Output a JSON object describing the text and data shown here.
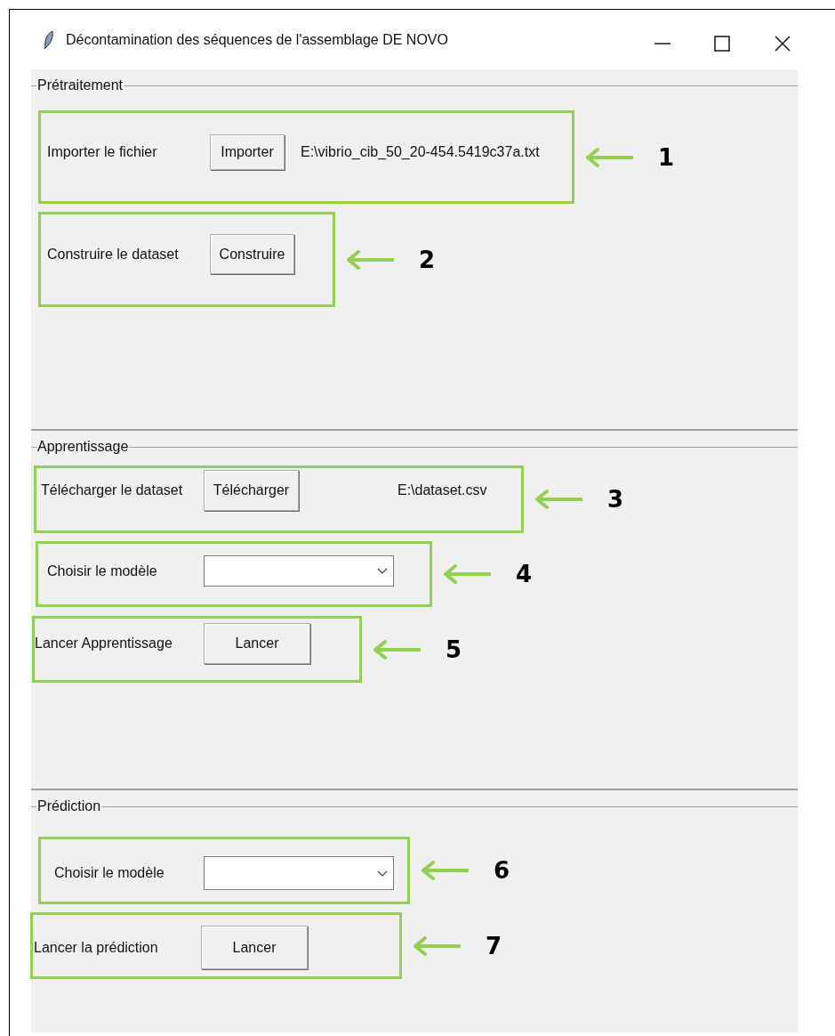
{
  "window": {
    "title": "Décontamination des séquences de l'assemblage DE NOVO"
  },
  "sections": [
    {
      "title": "Prétraitement",
      "rows": [
        {
          "kind": "button",
          "label": "Importer le fichier",
          "button": "Importer",
          "path": "E:\\vibrio_cib_50_20-454.5419c37a.txt",
          "callout": "1"
        },
        {
          "kind": "button",
          "label": "Construire le dataset",
          "button": "Construire",
          "callout": "2"
        }
      ]
    },
    {
      "title": "Apprentissage",
      "rows": [
        {
          "kind": "button",
          "label": "Télécharger le dataset",
          "button": "Télécharger",
          "path": "E:\\dataset.csv",
          "callout": "3"
        },
        {
          "kind": "combobox",
          "label": "Choisir le modèle",
          "callout": "4"
        },
        {
          "kind": "button",
          "label": "Lancer Apprentissage",
          "button": "Lancer",
          "callout": "5"
        }
      ]
    },
    {
      "title": "Prédiction",
      "rows": [
        {
          "kind": "combobox",
          "label": "Choisir le modèle",
          "callout": "6"
        },
        {
          "kind": "button",
          "label": "Lancer la prédiction",
          "button": "Lancer",
          "callout": "7"
        }
      ]
    }
  ]
}
